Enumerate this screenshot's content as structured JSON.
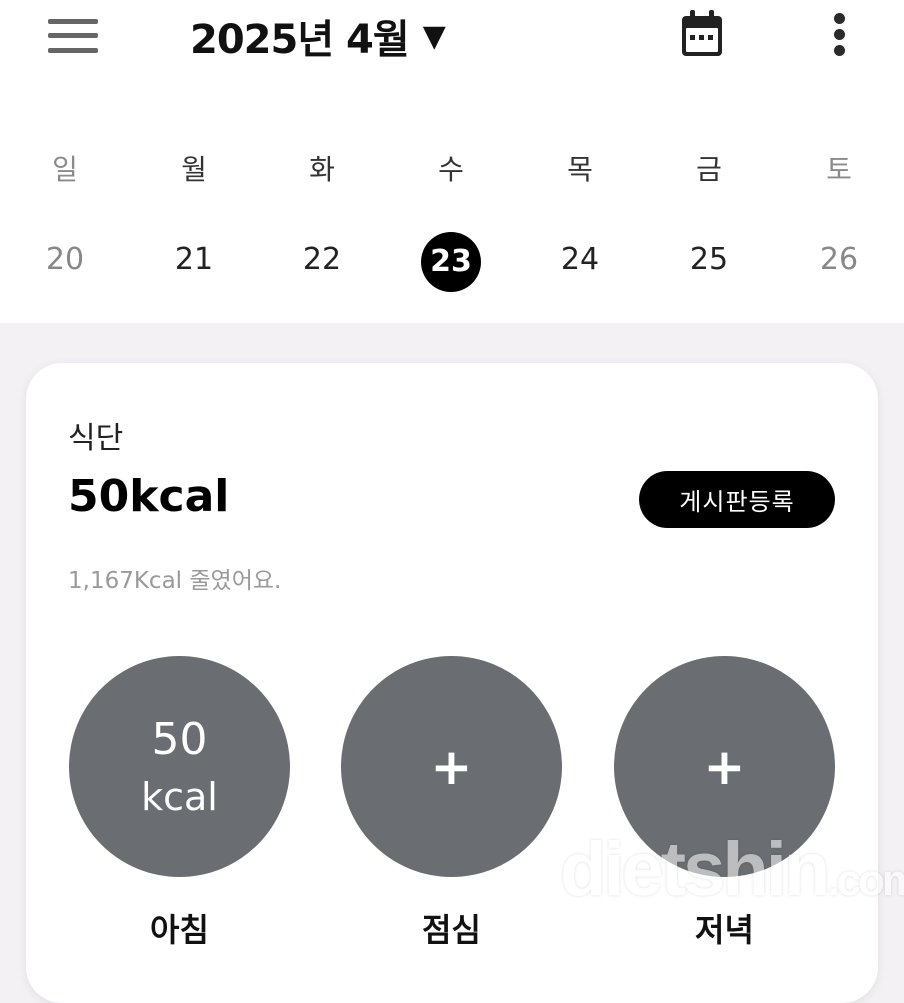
{
  "header": {
    "month_title": "2025년 4월",
    "dropdown_caret": "▼",
    "calendar_icon": "calendar-icon",
    "more_icon": "more-vertical-icon",
    "menu_icon": "hamburger-menu-icon"
  },
  "week": {
    "weekdays": [
      "일",
      "월",
      "화",
      "수",
      "목",
      "금",
      "토"
    ],
    "dates": [
      "20",
      "21",
      "22",
      "23",
      "24",
      "25",
      "26"
    ],
    "selected_index": 3
  },
  "diet_card": {
    "label": "식단",
    "total_kcal": "50kcal",
    "board_button": "게시판등록",
    "summary": "1,167Kcal 줄였어요.",
    "meals": [
      {
        "name": "아침",
        "value": "50",
        "unit": "kcal"
      },
      {
        "name": "점심",
        "plus": "+"
      },
      {
        "name": "저녁",
        "plus": "+"
      }
    ]
  },
  "watermark": {
    "brand": "dietshin",
    "suffix": ".com"
  },
  "colors": {
    "accent": "#000000",
    "meal_circle": "#6a6e72",
    "page_background": "#f4f1f5"
  }
}
